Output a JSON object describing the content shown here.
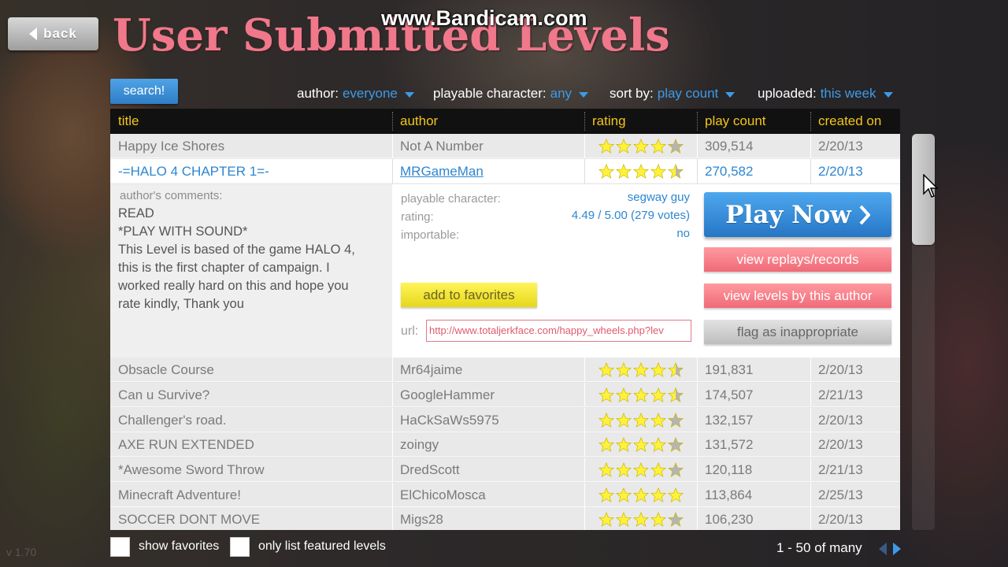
{
  "watermark": "www.Bandicam.com",
  "header": {
    "back_label": "back",
    "title": "User Submitted Levels"
  },
  "toolbar": {
    "search_label": "search!",
    "filters": [
      {
        "label": "author:",
        "value": "everyone"
      },
      {
        "label": "playable character:",
        "value": "any"
      },
      {
        "label": "sort by:",
        "value": "play count"
      },
      {
        "label": "uploaded:",
        "value": "this week"
      }
    ]
  },
  "table": {
    "columns": [
      "title",
      "author",
      "rating",
      "play count",
      "created on"
    ],
    "rows": [
      {
        "title": "Happy Ice Shores",
        "author": "Not A Number",
        "rating": 4,
        "play_count": "309,514",
        "created_on": "2/20/13"
      },
      {
        "title": "-=HALO 4 CHAPTER 1=-",
        "author": "MRGameMan",
        "rating": 4.5,
        "play_count": "270,582",
        "created_on": "2/20/13",
        "selected": true
      },
      {
        "title": "Obsacle Course",
        "author": "Mr64jaime",
        "rating": 4.5,
        "play_count": "191,831",
        "created_on": "2/20/13"
      },
      {
        "title": "Can u Survive?",
        "author": "GoogleHammer",
        "rating": 4.5,
        "play_count": "174,507",
        "created_on": "2/21/13"
      },
      {
        "title": "Challenger's road.",
        "author": "HaCkSaWs5975",
        "rating": 4,
        "play_count": "132,157",
        "created_on": "2/20/13"
      },
      {
        "title": "AXE RUN EXTENDED",
        "author": "zoingy",
        "rating": 4,
        "play_count": "131,572",
        "created_on": "2/20/13"
      },
      {
        "title": "*Awesome Sword Throw",
        "author": "DredScott",
        "rating": 4,
        "play_count": "120,118",
        "created_on": "2/21/13"
      },
      {
        "title": "Minecraft Adventure!",
        "author": "ElChicoMosca",
        "rating": 5,
        "play_count": "113,864",
        "created_on": "2/25/13"
      },
      {
        "title": "SOCCER DONT MOVE",
        "author": "Migs28",
        "rating": 4,
        "play_count": "106,230",
        "created_on": "2/20/13"
      }
    ]
  },
  "detail": {
    "comments_label": "author's comments:",
    "comments": [
      "READ",
      "*PLAY WITH SOUND*",
      "This Level is based of the game HALO 4,",
      "this is the first chapter of campaign. I",
      "worked really hard on this and hope you",
      "rate kindly, Thank you"
    ],
    "info": [
      {
        "label": "playable character:",
        "value": "segway guy"
      },
      {
        "label": "rating:",
        "value": "4.49 / 5.00 (279 votes)"
      },
      {
        "label": "importable:",
        "value": "no"
      }
    ],
    "add_favorites_label": "add to favorites",
    "url_label": "url:",
    "url_value": "http://www.totaljerkface.com/happy_wheels.php?lev",
    "play_now_label": "Play Now",
    "view_replays_label": "view replays/records",
    "view_levels_label": "view levels by this author",
    "flag_label": "flag as inappropriate"
  },
  "footer": {
    "show_favorites_label": "show favorites",
    "featured_label": "only list featured levels",
    "pagination": "1 - 50 of many"
  },
  "version": "v 1.70",
  "colors": {
    "title_pink": "#f0788a",
    "accent_blue": "#3c9be8",
    "header_yellow": "#f3c41c",
    "star_yellow": "#fff23a",
    "favorites_yellow": "#fff45a",
    "pink_button": "#f06a78"
  }
}
